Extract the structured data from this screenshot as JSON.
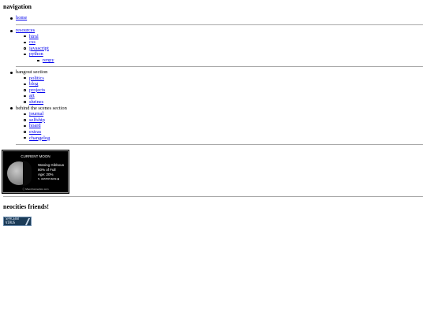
{
  "navigation": {
    "heading": "navigation",
    "home": "home",
    "resources": {
      "label": "resources",
      "items": [
        "html",
        "css",
        "javascript",
        "python"
      ],
      "python_sub": [
        "renpy"
      ]
    },
    "hangout": {
      "label": "hangout section",
      "items": [
        "politics",
        "blog",
        "projects",
        "art",
        "shrines"
      ]
    },
    "behind": {
      "label": "behind the scenes section",
      "items": [
        "journal",
        "selfship",
        "hoard",
        "extras",
        "changelog"
      ]
    }
  },
  "moon_widget": {
    "title": "CURRENT MOON",
    "phase": "Waning Gibbous",
    "percent_full": "80% of Full",
    "age": "Age: 20%",
    "hemisphere": "N. HEMISPHERE ◉",
    "credit": "ⓒ MoonConnection.com"
  },
  "friends": {
    "heading": "neocities friends!",
    "badge_text": "SPACE88\nVIRUS"
  }
}
